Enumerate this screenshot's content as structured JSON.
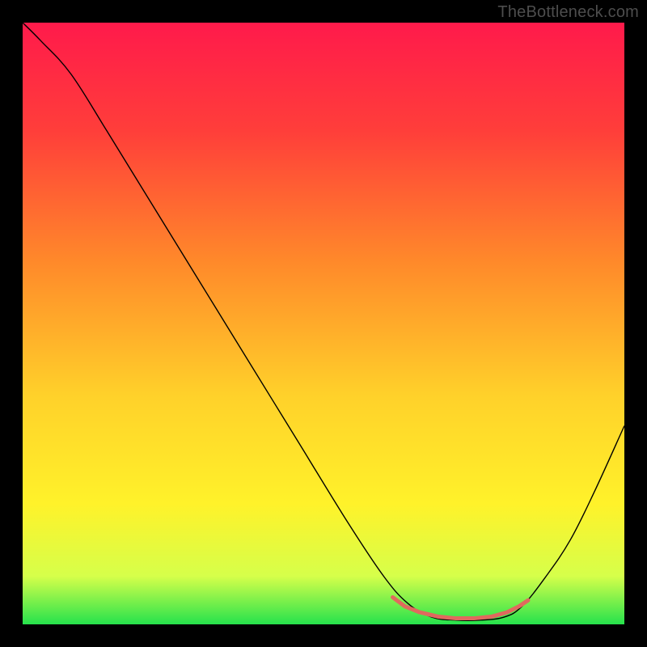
{
  "watermark": "TheBottleneck.com",
  "chart_data": {
    "type": "line",
    "title": "",
    "xlabel": "",
    "ylabel": "",
    "xlim": [
      0,
      100
    ],
    "ylim": [
      0,
      100
    ],
    "gradient_stops": [
      {
        "offset": 0,
        "color": "#ff1a4b"
      },
      {
        "offset": 18,
        "color": "#ff3e3a"
      },
      {
        "offset": 40,
        "color": "#ff8a2a"
      },
      {
        "offset": 62,
        "color": "#ffd12a"
      },
      {
        "offset": 80,
        "color": "#fff22a"
      },
      {
        "offset": 92,
        "color": "#d6ff4a"
      },
      {
        "offset": 100,
        "color": "#26e24c"
      }
    ],
    "main_curve": {
      "stroke": "#000000",
      "stroke_width": 1.4,
      "points": [
        {
          "x": 0,
          "y": 100
        },
        {
          "x": 3,
          "y": 97
        },
        {
          "x": 8,
          "y": 91.5
        },
        {
          "x": 14,
          "y": 82
        },
        {
          "x": 22,
          "y": 69
        },
        {
          "x": 30,
          "y": 56
        },
        {
          "x": 38,
          "y": 43
        },
        {
          "x": 46,
          "y": 30
        },
        {
          "x": 54,
          "y": 17
        },
        {
          "x": 60,
          "y": 8
        },
        {
          "x": 64,
          "y": 3.5
        },
        {
          "x": 68,
          "y": 1.2
        },
        {
          "x": 72,
          "y": 0.7
        },
        {
          "x": 76,
          "y": 0.7
        },
        {
          "x": 80,
          "y": 1.2
        },
        {
          "x": 83,
          "y": 3
        },
        {
          "x": 87,
          "y": 8
        },
        {
          "x": 91,
          "y": 14
        },
        {
          "x": 95,
          "y": 22
        },
        {
          "x": 100,
          "y": 33
        }
      ]
    },
    "marker_curve": {
      "stroke": "#e0695e",
      "stroke_width": 5,
      "linecap": "round",
      "points": [
        {
          "x": 61.5,
          "y": 4.5
        },
        {
          "x": 63.5,
          "y": 3.0
        },
        {
          "x": 66.0,
          "y": 2.0
        },
        {
          "x": 69.0,
          "y": 1.3
        },
        {
          "x": 72.0,
          "y": 1.0
        },
        {
          "x": 75.0,
          "y": 1.0
        },
        {
          "x": 78.0,
          "y": 1.3
        },
        {
          "x": 80.5,
          "y": 2.0
        },
        {
          "x": 82.5,
          "y": 3.0
        },
        {
          "x": 84.0,
          "y": 4.0
        }
      ]
    }
  }
}
